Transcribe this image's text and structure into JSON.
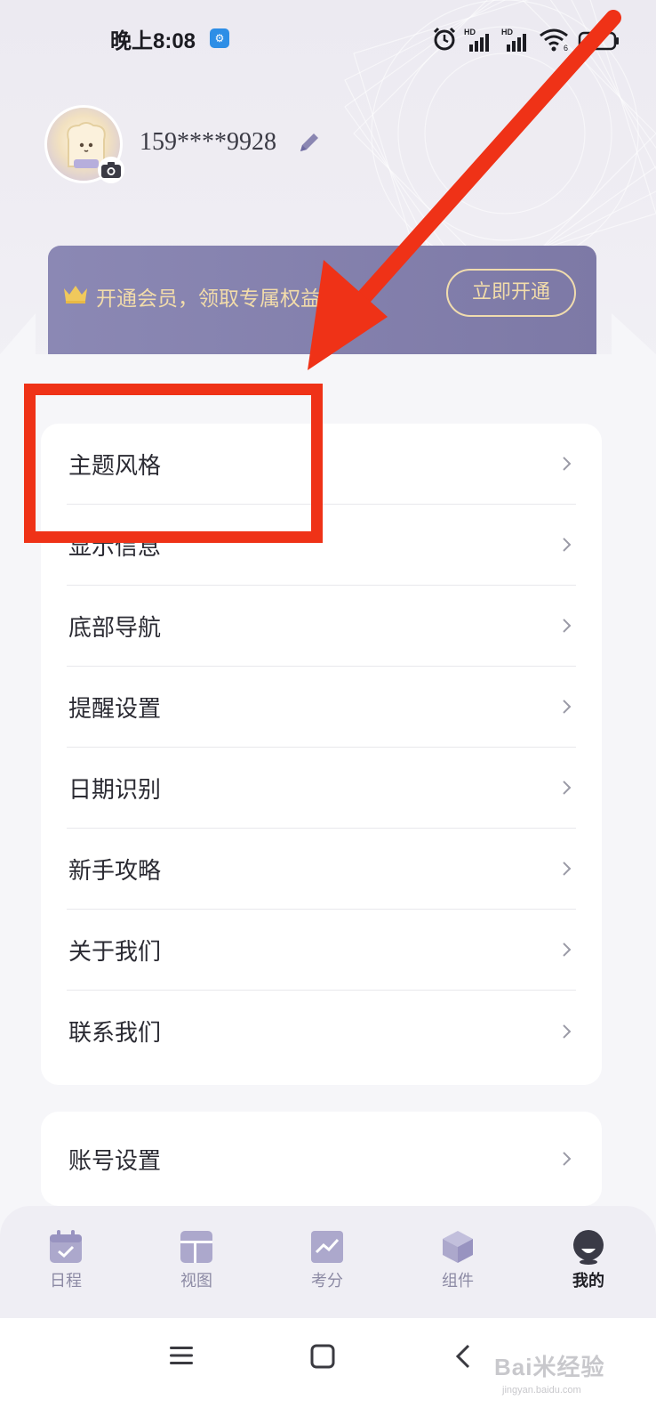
{
  "status_bar": {
    "time": "晚上8:08",
    "app_badge": "⚙",
    "hd_label_1": "HD",
    "hd_label_2": "HD",
    "wifi_sub": "6",
    "icons": [
      "alarm-icon",
      "signal-hd-icon",
      "signal-hd-icon",
      "wifi-icon",
      "battery-icon"
    ]
  },
  "profile": {
    "phone": "159****9928",
    "avatar_icon": "toast-avatar",
    "camera_icon": "camera-icon",
    "edit_icon": "pencil-icon"
  },
  "vip": {
    "text": "开通会员，领取专属权益",
    "button": "立即开通",
    "crown_icon": "crown-icon"
  },
  "menu": {
    "items": [
      {
        "label": "主题风格"
      },
      {
        "label": "显示信息"
      },
      {
        "label": "底部导航"
      },
      {
        "label": "提醒设置"
      },
      {
        "label": "日期识别"
      },
      {
        "label": "新手攻略"
      },
      {
        "label": "关于我们"
      },
      {
        "label": "联系我们"
      }
    ],
    "account": {
      "label": "账号设置"
    }
  },
  "bottom_nav": {
    "items": [
      {
        "label": "日程",
        "icon": "calendar-icon",
        "active": false
      },
      {
        "label": "视图",
        "icon": "layout-icon",
        "active": false
      },
      {
        "label": "考分",
        "icon": "chart-icon",
        "active": false
      },
      {
        "label": "组件",
        "icon": "cube-icon",
        "active": false
      },
      {
        "label": "我的",
        "icon": "profile-icon",
        "active": true
      }
    ]
  },
  "system_nav": {
    "buttons": [
      "menu-icon",
      "home-icon",
      "back-icon"
    ]
  },
  "watermark": {
    "text": "Bai米经验",
    "sub": "jingyan.baidu.com"
  },
  "colors": {
    "accent": "#7d79a6",
    "vip_gold": "#f2dcaa",
    "annotation_red": "#ef3217",
    "nav_inactive": "#8c8aa4"
  }
}
